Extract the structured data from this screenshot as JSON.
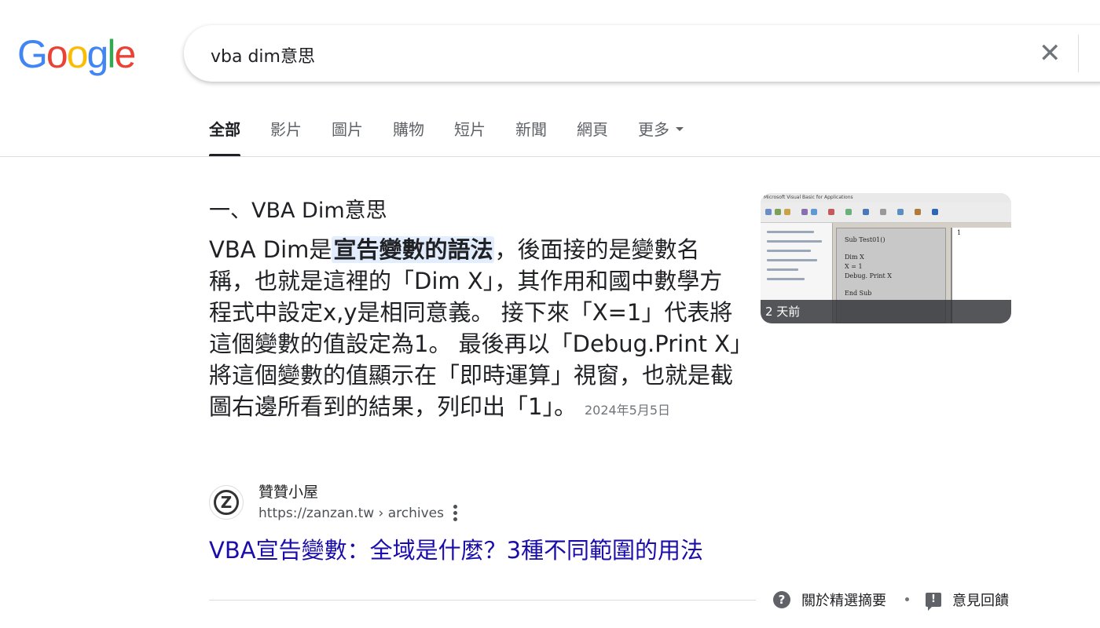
{
  "logo": {
    "letters": [
      "G",
      "o",
      "o",
      "g",
      "l",
      "e"
    ],
    "colors": [
      "#4285F4",
      "#EA4335",
      "#FBBC05",
      "#4285F4",
      "#34A853",
      "#EA4335"
    ]
  },
  "search": {
    "query": "vba dim意思",
    "clear_glyph": "✕"
  },
  "tabs": [
    {
      "label": "全部",
      "active": true
    },
    {
      "label": "影片",
      "active": false
    },
    {
      "label": "圖片",
      "active": false
    },
    {
      "label": "購物",
      "active": false
    },
    {
      "label": "短片",
      "active": false
    },
    {
      "label": "新聞",
      "active": false
    },
    {
      "label": "網頁",
      "active": false
    },
    {
      "label": "更多",
      "active": false
    }
  ],
  "snippet": {
    "heading": "一、VBA Dim意思",
    "text_before": "VBA Dim是",
    "highlight": "宣告變數的語法",
    "text_after": "，後面接的是變數名稱，也就是這裡的「Dim X」，其作用和國中數學方程式中設定x,y是相同意義。 接下來「X=1」代表將這個變數的值設定為1。 最後再以「Debug.Print X」將這個變數的值顯示在「即時運算」視窗，也就是截圖右邊所看到的結果，列印出「1」。",
    "date": "2024年5月5日"
  },
  "thumbnail": {
    "caption": "2 天前",
    "code_lines": [
      "Sub Test01()",
      "Dim X",
      "X = 1",
      "Debug. Print X",
      "End Sub"
    ],
    "output_value": "1",
    "titlebar": "Microsoft Visual Basic for Applications"
  },
  "source": {
    "favicon_letter": "Z",
    "site_name": "贊贊小屋",
    "url": "https://zanzan.tw › archives",
    "title": "VBA宣告變數：全域是什麼？3種不同範圍的用法"
  },
  "footer": {
    "help_glyph": "?",
    "about_label": "關於精選摘要",
    "feedback_glyph": "!",
    "feedback_label": "意見回饋"
  }
}
